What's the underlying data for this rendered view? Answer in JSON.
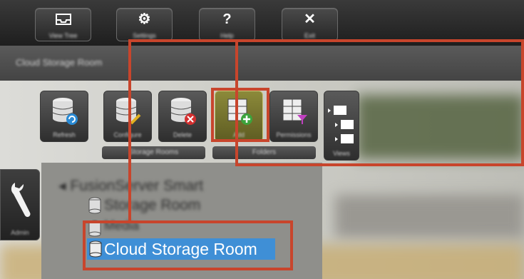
{
  "toolbar": {
    "buttons": [
      {
        "icon": "tray-icon",
        "glyph": "",
        "label": "View Tree"
      },
      {
        "icon": "gear-icon",
        "glyph": "⚙",
        "label": "Settings"
      },
      {
        "icon": "help-icon",
        "glyph": "?",
        "label": "Help"
      },
      {
        "icon": "close-icon",
        "glyph": "✕",
        "label": "Exit"
      }
    ]
  },
  "title_bar": {
    "text": "Cloud Storage Room"
  },
  "tools": [
    {
      "label": "Refresh"
    },
    {
      "label": "Configure"
    },
    {
      "label": "Delete"
    },
    {
      "label": "Add"
    },
    {
      "label": "Permissions"
    },
    {
      "label": "Views"
    }
  ],
  "groups": [
    {
      "label": "Storage Rooms"
    },
    {
      "label": "Folders"
    }
  ],
  "side_tab": {
    "label": "Admin"
  },
  "tree": {
    "root": "FusionServer Smart",
    "items": [
      {
        "label": "Storage Room"
      },
      {
        "label": "Media"
      },
      {
        "label": "Cloud Storage Room",
        "selected": true
      }
    ]
  },
  "colors": {
    "highlight": "#c8452c",
    "selection": "#3f8fd6"
  }
}
